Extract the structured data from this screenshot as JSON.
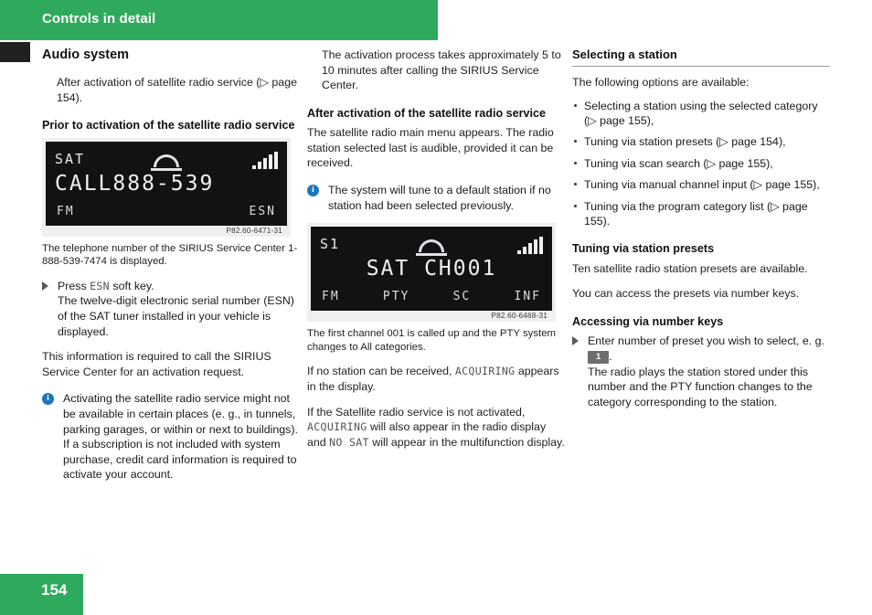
{
  "header": {
    "chapter_title": "Controls in detail",
    "topic_title": "Audio system",
    "green": "#2faa5d"
  },
  "footer": {
    "page_number": "154"
  },
  "column1": {
    "intro": "After activation of satellite radio service (▷ page 154).",
    "heading_prior": "Prior to activation of the satellite radio service",
    "figure": {
      "top_left": "SAT",
      "main": "CALL888-539",
      "bottom_left": "FM",
      "bottom_right": "ESN",
      "code": "P82.60-6471-31",
      "phone_icon": "phone-handset-icon",
      "signal_icon": "signal-bars-icon"
    },
    "caption": "The telephone number of the SIRIUS Service Center 1-888-539-7474 is displayed.",
    "step": {
      "lead_pre": "Press ",
      "lead_key": "ESN",
      "lead_post": " soft key.",
      "detail": "The twelve-digit electronic serial number (ESN) of the SAT tuner installed in your vehicle is displayed."
    },
    "para_required": "This information is required to call the SIRIUS Service Center for an activation request.",
    "note": "Activating the satellite radio service might not be available in certain places (e. g., in tunnels, parking garages, or within or next to buildings). If a subscription is not included with system purchase, credit card information is required to activate your account."
  },
  "column2": {
    "intro": "The activation process takes approximately 5 to 10 minutes after calling the SIRIUS Service Center.",
    "heading_after": "After activation of the satellite radio service",
    "para_main_menu": "The satellite radio main menu appears. The radio station selected last is audible, provided it can be received.",
    "note": "The system will tune to a default station if no station had been selected previously.",
    "figure": {
      "top_left": "S1",
      "main": "SAT  CH001",
      "softkeys": [
        "FM",
        "PTY",
        "SC",
        "INF"
      ],
      "code": "P82.60-6468-31",
      "phone_icon": "phone-handset-icon",
      "signal_icon": "signal-bars-icon"
    },
    "caption": "The first channel 001 is called up and the PTY system changes to All categories.",
    "para_no_station_pre": "If no station can be received, ",
    "para_no_station_lcd": "ACQUIRING",
    "para_no_station_post": " appears in the display.",
    "para_not_activated_a": "If the Satellite radio service is not activated, ",
    "para_not_activated_lcd1": "ACQUIRING",
    "para_not_activated_b": " will also appear in the radio display and ",
    "para_not_activated_lcd2": "NO SAT",
    "para_not_activated_c": " will appear in the multifunction display."
  },
  "column3": {
    "section_heading": "Selecting a station",
    "lead": "The following options are available:",
    "options": [
      "Selecting a station using the selected category (▷ page 155),",
      "Tuning via station presets (▷ page 154),",
      "Tuning via scan search (▷ page 155),",
      "Tuning via manual channel input (▷ page 155),",
      "Tuning via the program category list (▷ page 155)."
    ],
    "heading_presets": "Tuning via station presets",
    "para_presets_1": "Ten satellite radio station presets are available.",
    "para_presets_2": "You can access the presets via number keys.",
    "heading_number_keys": "Accessing via number keys",
    "step": {
      "lead_pre": "Enter number of preset you wish to select, e. g. ",
      "key_label": "1",
      "lead_post": ".",
      "detail": "The radio plays the station stored under this number and the PTY function changes to the category corresponding to the station."
    }
  }
}
